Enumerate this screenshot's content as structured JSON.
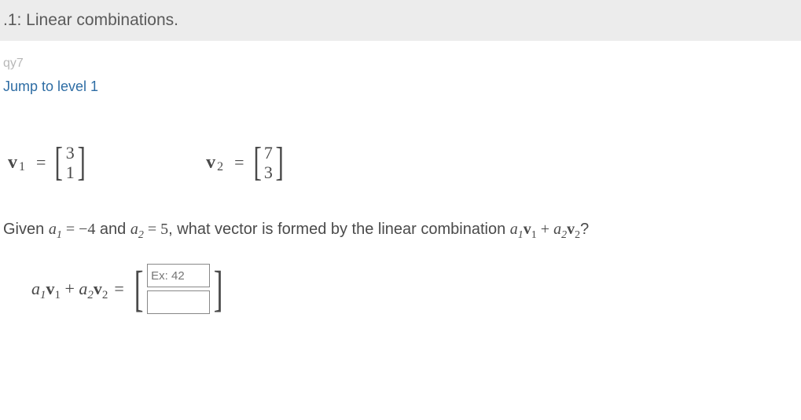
{
  "banner": {
    "title": ".1: Linear combinations."
  },
  "tag": "qy7",
  "jump": {
    "label": "Jump to level 1"
  },
  "vectors": {
    "v1": {
      "label": "v",
      "sub": "1",
      "eq": "=",
      "top": "3",
      "bottom": "1"
    },
    "v2": {
      "label": "v",
      "sub": "2",
      "eq": "=",
      "top": "7",
      "bottom": "3"
    }
  },
  "prompt": {
    "pre": "Given ",
    "a1": "a",
    "a1sub": "1",
    "eq1": " = ",
    "v1": "−4",
    "mid": " and ",
    "a2": "a",
    "a2sub": "2",
    "eq2": " = ",
    "v2": "5",
    "tail1": ", what vector is formed by the linear combination ",
    "expr_a1": "a",
    "expr_a1s": "1",
    "expr_v1": "v",
    "expr_v1s": "1",
    "plus": " + ",
    "expr_a2": "a",
    "expr_a2s": "2",
    "expr_v2": "v",
    "expr_v2s": "2",
    "q": "?"
  },
  "answer": {
    "lhs_a1": "a",
    "lhs_a1s": "1",
    "lhs_v1": "v",
    "lhs_v1s": "1",
    "plus": " + ",
    "lhs_a2": "a",
    "lhs_a2s": "2",
    "lhs_v2": "v",
    "lhs_v2s": "2",
    "eq": "=",
    "input1": {
      "placeholder": "Ex: 42"
    },
    "input2": {
      "placeholder": ""
    }
  }
}
